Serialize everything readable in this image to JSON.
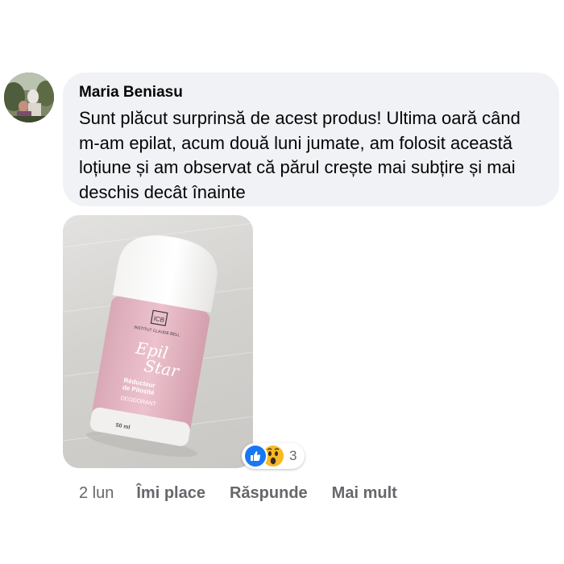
{
  "comment": {
    "author": "Maria Beniasu",
    "text": "Sunt plăcut surprinsă de acest produs! Ultima oară când m-am epilat, acum două luni jumate, am folosit această loțiune și am observat că părul crește mai subțire și mai deschis decât înainte"
  },
  "product_photo": {
    "brand": "INSTITUT CLAUDE BELL",
    "logo": "ICB",
    "name_line1": "Epil",
    "name_line2": "Star",
    "subtitle_line1": "Réducteur",
    "subtitle_line2": "de Pilosité",
    "category": "DEODORANT",
    "volume": "50 ml"
  },
  "reactions": {
    "icons": [
      "like-icon",
      "wow-icon"
    ],
    "count": "3",
    "colors": {
      "like": "#1877f2",
      "wow": "#f7b928"
    }
  },
  "actions": {
    "time": "2 lun",
    "like_label": "Îmi place",
    "reply_label": "Răspunde",
    "more_label": "Mai mult"
  },
  "colors": {
    "bubble": "#f0f2f5",
    "meta_text": "#65676b",
    "text": "#050505"
  }
}
